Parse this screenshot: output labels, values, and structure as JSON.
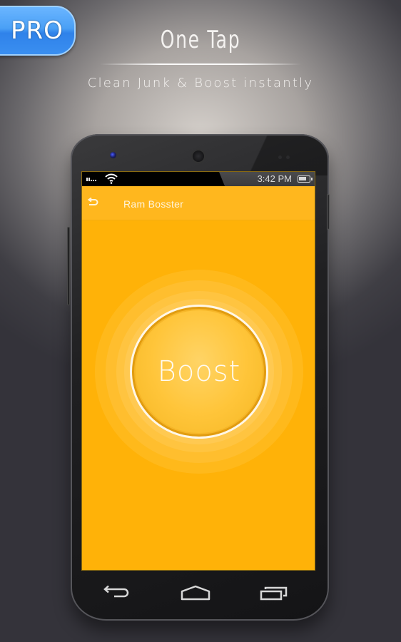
{
  "badge": {
    "label": "PRO",
    "color": "#3a8ff0"
  },
  "headline": "One Tap",
  "tagline": "Clean Junk & Boost instantly",
  "phone": {
    "status_bar": {
      "time": "3:42 PM",
      "icons": [
        "signal-icon",
        "wifi-icon",
        "battery-icon"
      ]
    },
    "app_bar": {
      "back_icon": "back-arrow-icon",
      "title": "Ram Bosster",
      "color": "#ffb71e"
    },
    "main": {
      "boost_button_label": "Boost",
      "background_color": "#ffb208"
    },
    "nav_bar": {
      "buttons": [
        {
          "name": "back",
          "icon": "nav-back-icon"
        },
        {
          "name": "home",
          "icon": "nav-home-icon"
        },
        {
          "name": "recent-apps",
          "icon": "nav-recents-icon"
        }
      ]
    }
  }
}
